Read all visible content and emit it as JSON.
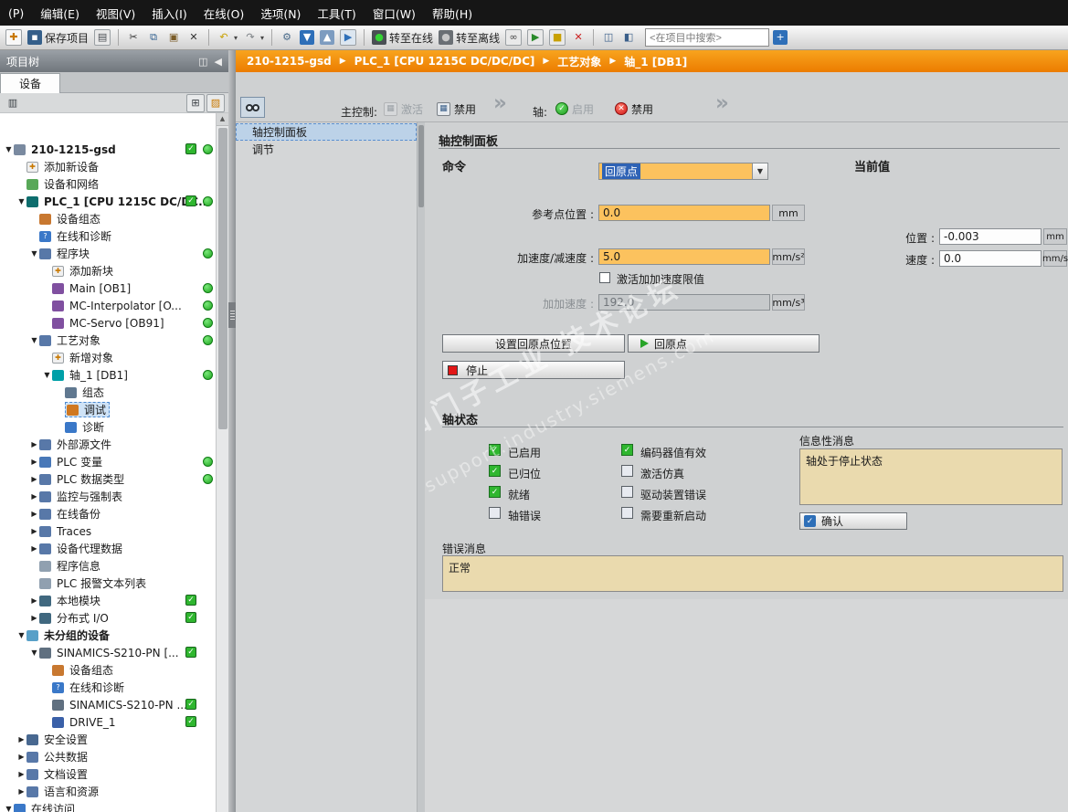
{
  "menu": {
    "items": [
      "(P)",
      "编辑(E)",
      "视图(V)",
      "插入(I)",
      "在线(O)",
      "选项(N)",
      "工具(T)",
      "窗口(W)",
      "帮助(H)"
    ]
  },
  "toolbar": {
    "items": [
      {
        "type": "icon",
        "name": "new-project-icon",
        "glyph": "✚",
        "fg": "#c87800",
        "bg": "#f8f8f8",
        "border": true
      },
      {
        "type": "button",
        "name": "save-project-button",
        "icon_name": "save-icon",
        "glyph": "▪",
        "fg": "#ffffff",
        "bg": "#355f8a",
        "label": "保存项目"
      },
      {
        "type": "icon",
        "name": "print-icon",
        "glyph": "▤",
        "fg": "#4a4f54",
        "bg": "#e9e9e9",
        "border": true
      },
      {
        "type": "sep"
      },
      {
        "type": "icon",
        "name": "cut-icon",
        "glyph": "✂",
        "fg": "#333333"
      },
      {
        "type": "icon",
        "name": "copy-icon",
        "glyph": "⧉",
        "fg": "#2f5f8f"
      },
      {
        "type": "icon",
        "name": "paste-icon",
        "glyph": "▣",
        "fg": "#7a5c28"
      },
      {
        "type": "icon",
        "name": "delete-icon",
        "glyph": "✕",
        "fg": "#333333"
      },
      {
        "type": "sep"
      },
      {
        "type": "icon",
        "name": "undo-icon",
        "glyph": "↶",
        "fg": "#c8a000",
        "caret": true
      },
      {
        "type": "icon",
        "name": "redo-icon",
        "glyph": "↷",
        "fg": "#7a7f84",
        "caret": true
      },
      {
        "type": "sep"
      },
      {
        "type": "icon",
        "name": "compile-icon",
        "glyph": "⚙",
        "fg": "#4a6b8a"
      },
      {
        "type": "icon",
        "name": "download-to-device-icon",
        "glyph": "▼",
        "fg": "#ffffff",
        "bg": "#2e6fb8"
      },
      {
        "type": "icon",
        "name": "upload-from-device-icon",
        "glyph": "▲",
        "fg": "#ffffff",
        "bg": "#7d9cc0"
      },
      {
        "type": "icon",
        "name": "start-simulation-icon",
        "glyph": "▶",
        "fg": "#2e6fb8",
        "bg": "#dce6f0",
        "border": true
      },
      {
        "type": "sep"
      },
      {
        "type": "button",
        "name": "go-online-button",
        "icon_name": "go-online-icon",
        "glyph": "●",
        "fg": "#35d435",
        "bg": "#4a4f54",
        "label": "转至在线"
      },
      {
        "type": "button",
        "name": "go-offline-button",
        "icon_name": "go-offline-icon",
        "glyph": "●",
        "fg": "#c8c8c8",
        "bg": "#6a6f74",
        "label": "转至离线"
      },
      {
        "type": "icon",
        "name": "accessible-devices-icon",
        "glyph": "∞",
        "fg": "#444444",
        "bg": "#e9e9e9",
        "border": true
      },
      {
        "type": "icon",
        "name": "start-cpu-icon",
        "glyph": "▶",
        "fg": "#2a8a2a",
        "bg": "#e9e9e9",
        "border": true
      },
      {
        "type": "icon",
        "name": "stop-cpu-icon",
        "glyph": "■",
        "fg": "#c8a000",
        "bg": "#e9e9e9",
        "border": true
      },
      {
        "type": "icon",
        "name": "cross-references-icon",
        "glyph": "✕",
        "fg": "#cc2222"
      },
      {
        "type": "sep"
      },
      {
        "type": "icon",
        "name": "split-editor-horizontal-icon",
        "glyph": "◫",
        "fg": "#3a5f8a"
      },
      {
        "type": "icon",
        "name": "split-editor-vertical-icon",
        "glyph": "◧",
        "fg": "#3a5f8a"
      },
      {
        "type": "search",
        "name": "project-search-input",
        "value": "<在项目中搜索>"
      },
      {
        "type": "icon",
        "name": "library-search-icon",
        "glyph": "+",
        "fg": "#ffffff",
        "bg": "#2e6fb8"
      }
    ]
  },
  "breadcrumb": {
    "items": [
      "210-1215-gsd",
      "PLC_1 [CPU 1215C DC/DC/DC]",
      "工艺对象",
      "轴_1 [DB1]"
    ]
  },
  "project_tree": {
    "title": "项目树",
    "tab": "设备",
    "items": [
      {
        "label": "210-1215-gsd",
        "level": 0,
        "exp": "open",
        "icon": "project-icon",
        "check": true,
        "dot": true,
        "bold": true
      },
      {
        "label": "添加新设备",
        "level": 1,
        "icon": "add-device-icon"
      },
      {
        "label": "设备和网络",
        "level": 1,
        "icon": "devices-networks-icon"
      },
      {
        "label": "PLC_1 [CPU 1215C DC/DC...",
        "level": 1,
        "exp": "open",
        "icon": "plc-icon",
        "check": true,
        "dot": true,
        "bold": true
      },
      {
        "label": "设备组态",
        "level": 2,
        "icon": "device-config-icon"
      },
      {
        "label": "在线和诊断",
        "level": 2,
        "icon": "online-diag-icon"
      },
      {
        "label": "程序块",
        "level": 2,
        "exp": "open",
        "icon": "program-blocks-icon",
        "dot": true
      },
      {
        "label": "添加新块",
        "level": 3,
        "icon": "add-block-icon"
      },
      {
        "label": "Main [OB1]",
        "level": 3,
        "icon": "ob-block-icon",
        "dot": true
      },
      {
        "label": "MC-Interpolator [O...",
        "level": 3,
        "icon": "ob-block-icon",
        "dot": true
      },
      {
        "label": "MC-Servo [OB91]",
        "level": 3,
        "icon": "ob-block-icon",
        "dot": true
      },
      {
        "label": "工艺对象",
        "level": 2,
        "exp": "open",
        "icon": "tech-objects-icon",
        "dot": true
      },
      {
        "label": "新增对象",
        "level": 3,
        "icon": "add-object-icon"
      },
      {
        "label": "轴_1 [DB1]",
        "level": 3,
        "exp": "open",
        "icon": "axis-icon",
        "dot": true
      },
      {
        "label": "组态",
        "level": 4,
        "icon": "configuration-icon"
      },
      {
        "label": "调试",
        "level": 4,
        "icon": "commissioning-icon",
        "sel": true
      },
      {
        "label": "诊断",
        "level": 4,
        "icon": "diagnostics-icon"
      },
      {
        "label": "外部源文件",
        "level": 2,
        "exp": "closed",
        "icon": "folder-icon"
      },
      {
        "label": "PLC 变量",
        "level": 2,
        "exp": "closed",
        "icon": "plc-tags-icon",
        "dot": true
      },
      {
        "label": "PLC 数据类型",
        "level": 2,
        "exp": "closed",
        "icon": "data-types-icon",
        "dot": true
      },
      {
        "label": "监控与强制表",
        "level": 2,
        "exp": "closed",
        "icon": "watch-tables-icon"
      },
      {
        "label": "在线备份",
        "level": 2,
        "exp": "closed",
        "icon": "online-backup-icon"
      },
      {
        "label": "Traces",
        "level": 2,
        "exp": "closed",
        "icon": "traces-icon"
      },
      {
        "label": "设备代理数据",
        "level": 2,
        "exp": "closed",
        "icon": "proxy-data-icon"
      },
      {
        "label": "程序信息",
        "level": 2,
        "icon": "program-info-icon"
      },
      {
        "label": "PLC 报警文本列表",
        "level": 2,
        "icon": "alarm-text-icon"
      },
      {
        "label": "本地模块",
        "level": 2,
        "exp": "closed",
        "icon": "local-modules-icon",
        "check": true
      },
      {
        "label": "分布式 I/O",
        "level": 2,
        "exp": "closed",
        "icon": "distributed-io-icon",
        "check": true
      },
      {
        "label": "未分组的设备",
        "level": 1,
        "exp": "open",
        "icon": "ungrouped-devices-icon",
        "bold": true
      },
      {
        "label": "SINAMICS-S210-PN [...",
        "level": 2,
        "exp": "open",
        "icon": "drive-device-icon",
        "check": true
      },
      {
        "label": "设备组态",
        "level": 3,
        "icon": "device-config-icon"
      },
      {
        "label": "在线和诊断",
        "level": 3,
        "icon": "online-diag-icon"
      },
      {
        "label": "SINAMICS-S210-PN ...",
        "level": 3,
        "icon": "drive-module-icon",
        "check": true
      },
      {
        "label": "DRIVE_1",
        "level": 3,
        "icon": "drive-icon",
        "check": true
      },
      {
        "label": "安全设置",
        "level": 1,
        "exp": "closed",
        "icon": "security-icon"
      },
      {
        "label": "公共数据",
        "level": 1,
        "exp": "closed",
        "icon": "common-data-icon"
      },
      {
        "label": "文档设置",
        "level": 1,
        "exp": "closed",
        "icon": "doc-settings-icon"
      },
      {
        "label": "语言和资源",
        "level": 1,
        "exp": "closed",
        "icon": "languages-icon"
      },
      {
        "label": "在线访问",
        "level": 0,
        "exp": "open",
        "icon": "online-access-icon"
      }
    ]
  },
  "icon_styles": {
    "project-icon": {
      "bg": "#7a8aa0"
    },
    "add-device-icon": {
      "bg": "#f0f0f0",
      "g": "✚",
      "fg": "#c87800",
      "border": true
    },
    "devices-networks-icon": {
      "bg": "#58a858"
    },
    "plc-icon": {
      "bg": "#0e6e6e"
    },
    "device-config-icon": {
      "bg": "#c87830"
    },
    "online-diag-icon": {
      "bg": "#3a78c8",
      "g": "?"
    },
    "program-blocks-icon": {
      "bg": "#5878a8"
    },
    "add-block-icon": {
      "bg": "#f0f0f0",
      "g": "✚",
      "fg": "#c87800",
      "border": true
    },
    "ob-block-icon": {
      "bg": "#8050a0"
    },
    "tech-objects-icon": {
      "bg": "#5878a8"
    },
    "add-object-icon": {
      "bg": "#f0f0f0",
      "g": "✚",
      "fg": "#c87800",
      "border": true
    },
    "axis-icon": {
      "bg": "#00a0a8"
    },
    "configuration-icon": {
      "bg": "#607890"
    },
    "commissioning-icon": {
      "bg": "#d07820"
    },
    "diagnostics-icon": {
      "bg": "#3a78c8"
    },
    "folder-icon": {
      "bg": "#5878a8"
    },
    "plc-tags-icon": {
      "bg": "#4878b8"
    },
    "data-types-icon": {
      "bg": "#5878a8"
    },
    "watch-tables-icon": {
      "bg": "#5878a8"
    },
    "online-backup-icon": {
      "bg": "#5878a8"
    },
    "traces-icon": {
      "bg": "#5878a8"
    },
    "proxy-data-icon": {
      "bg": "#5878a8"
    },
    "program-info-icon": {
      "bg": "#90a0b0"
    },
    "alarm-text-icon": {
      "bg": "#90a0b0"
    },
    "local-modules-icon": {
      "bg": "#40687f"
    },
    "distributed-io-icon": {
      "bg": "#40687f"
    },
    "ungrouped-devices-icon": {
      "bg": "#58a0c8"
    },
    "drive-device-icon": {
      "bg": "#607080"
    },
    "drive-module-icon": {
      "bg": "#607080"
    },
    "drive-icon": {
      "bg": "#3a60a8"
    },
    "security-icon": {
      "bg": "#486890"
    },
    "common-data-icon": {
      "bg": "#5878a8"
    },
    "doc-settings-icon": {
      "bg": "#5878a8"
    },
    "languages-icon": {
      "bg": "#5878a8"
    },
    "online-access-icon": {
      "bg": "#3a78c8"
    }
  },
  "nav_panel": {
    "items": [
      {
        "label": "轴控制面板",
        "selected": true
      },
      {
        "label": "调节",
        "selected": false
      }
    ]
  },
  "control_bar": {
    "master_label": "主控制:",
    "master_activate": "激活",
    "master_disable": "禁用",
    "axis_label": "轴:",
    "axis_enable": "启用",
    "axis_disable": "禁用"
  },
  "panel": {
    "title": "轴控制面板",
    "command": {
      "title": "命令",
      "mode_value": "回原点",
      "fields": [
        {
          "label": "参考点位置 :",
          "value": "0.0",
          "unit": "mm",
          "disabled": false
        },
        {
          "label": "加速度/减速度 :",
          "value": "5.0",
          "unit": "mm/s²",
          "disabled": false
        },
        {
          "label": "加加速度 :",
          "value": "192.0",
          "unit": "mm/s³",
          "disabled": true
        }
      ],
      "jerk_checkbox_label": "激活加加速度限值",
      "jerk_checkbox_checked": false,
      "set_home_button": "设置回原点位置",
      "home_button": "回原点",
      "stop_button": "停止"
    },
    "current": {
      "title": "当前值",
      "fields": [
        {
          "label": "位置 :",
          "value": "-0.003",
          "unit": "mm"
        },
        {
          "label": "速度 :",
          "value": "0.0",
          "unit": "mm/s"
        }
      ]
    },
    "axis_status": {
      "title": "轴状态",
      "columns": [
        [
          {
            "label": "已启用",
            "on": true
          },
          {
            "label": "已归位",
            "on": true
          },
          {
            "label": "就绪",
            "on": true
          },
          {
            "label": "轴错误",
            "on": false
          }
        ],
        [
          {
            "label": "编码器值有效",
            "on": true
          },
          {
            "label": "激活仿真",
            "on": false
          },
          {
            "label": "驱动装置错误",
            "on": false
          },
          {
            "label": "需要重新启动",
            "on": false
          }
        ]
      ],
      "info_title": "信息性消息",
      "info_message": "轴处于停止状态",
      "ack_button": "确认",
      "error_title": "错误消息",
      "error_message": "正常"
    }
  },
  "watermark": {
    "line1": "西门子工业 技术论坛",
    "line2": "support.industry.siemens.com"
  },
  "colors": {
    "accent_orange": "#ee8400",
    "input_orange": "#fcc25e",
    "status_green": "#2fb62f",
    "selection_blue": "#2f63b5",
    "message_tan": "#eadaae"
  }
}
